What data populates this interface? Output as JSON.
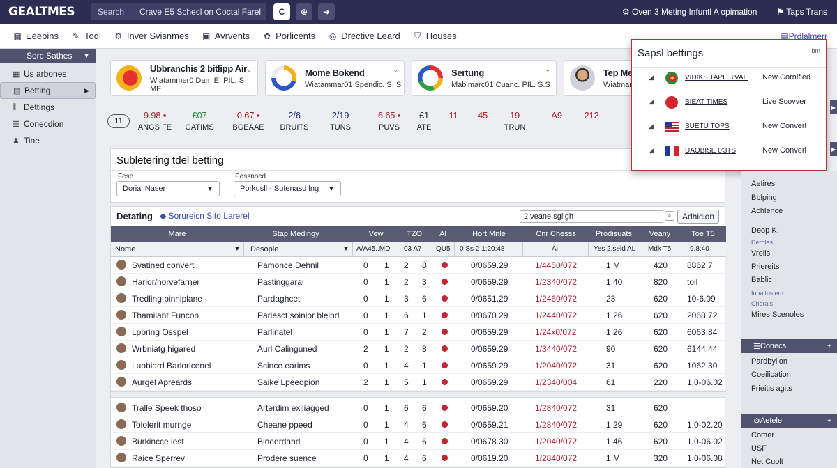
{
  "header": {
    "logo": "GEALTMES",
    "search_scope": "Search",
    "search_query": "Crave E5 Schecl on Coctal Farel",
    "btn_c": "C",
    "notice": "Oven 3 Meting Infuntl A opimation",
    "user": "Taps Trans"
  },
  "nav": {
    "items": [
      "Eeebins",
      "Todl",
      "Inver Svisnmes",
      "Avrvents",
      "Porlicents",
      "Drective Leard",
      "Houses"
    ],
    "right": "Prdlalmerr"
  },
  "sidebar": {
    "title": "Sorc Sathes",
    "items": [
      {
        "label": "Us arbones",
        "icon": "grid-icon",
        "selected": false
      },
      {
        "label": "Betting",
        "icon": "chart-icon",
        "selected": true
      },
      {
        "label": "Dettings",
        "icon": "bars-icon",
        "selected": false
      },
      {
        "label": "Conecdion",
        "icon": "list-icon",
        "selected": false
      },
      {
        "label": "Tine",
        "icon": "person-icon",
        "selected": false
      }
    ]
  },
  "cards": [
    {
      "title": "Ubbranchis 2 bitlipp Air",
      "subtitle": "Wiatammer0 Dam E. PIL. S ME",
      "icon": "red-yellow-logo"
    },
    {
      "title": "Mome Bokend",
      "subtitle": "Wiatammar01 Spendic. S. S",
      "icon": "blue-ring-logo"
    },
    {
      "title": "Sertung",
      "subtitle": "Mabimarc01 Cuanc. PIL. S.S",
      "icon": "multicolor-ring-logo"
    },
    {
      "title": "Tep Mec",
      "subtitle": "Wiatmanu",
      "icon": "person-avatar"
    }
  ],
  "stats": [
    {
      "value": "9.98 ▪",
      "label": "ANGS FE",
      "color": "red"
    },
    {
      "value": "£07",
      "label": "GATIMS",
      "color": "green"
    },
    {
      "value": "0.67 ▪",
      "label": "BGEAAE",
      "color": "red"
    },
    {
      "value": "2/6",
      "label": "DRUITS",
      "color": "blue"
    },
    {
      "value": "2/19",
      "label": "TUNS",
      "color": "blue"
    },
    {
      "value": "6.65 ▪",
      "label": "PUVS",
      "color": "red"
    },
    {
      "value": "£1",
      "label": "ATE",
      "color": "dark"
    },
    {
      "value": "11",
      "label": "",
      "color": "red"
    },
    {
      "value": "45",
      "label": "",
      "color": "red"
    },
    {
      "value": "19",
      "label": "TRUN",
      "color": "red"
    },
    {
      "value": "A9",
      "label": "",
      "color": "red"
    },
    {
      "value": "212",
      "label": "",
      "color": "red"
    }
  ],
  "stats_pill": "11",
  "settings": {
    "title": "Subletering tdel betting",
    "label1": "Fese",
    "select1": "Dorial Naser",
    "label2": "Pessnocd",
    "select2": "Porkusll - Sutenasd lng"
  },
  "table": {
    "title": "Detating",
    "subtitle": "Sorureicn Sito Larerel",
    "search": "2 veane.sgiigh",
    "add_label": "Adhicion",
    "columns": [
      "Mare",
      "Stap Medingy",
      "Vew",
      "TZO",
      "Al",
      "Hort Mnle",
      "Cnr Chesss",
      "Prodisuats",
      "Veany",
      "Toe T5"
    ],
    "subheader": [
      "Nome",
      "Desopie",
      "A/A45..MD",
      "03 A7",
      "QU5",
      "0 Ss 2 1:20:48",
      "Al",
      "Yes 2.seld AL",
      "Mdk T5",
      "9.8:40"
    ],
    "rows": [
      {
        "name": "Svatined convert",
        "desc": "Pamonce Dehnil",
        "a": "0",
        "b": "1",
        "c": "2",
        "d": "8",
        "time": "0/0659.29",
        "ratio": "1/4450/072",
        "prod": "1 M",
        "val": "420",
        "total": "8862.7"
      },
      {
        "name": "Harlor/horvefarner",
        "desc": "Pastinggarai",
        "a": "0",
        "b": "1",
        "c": "2",
        "d": "3",
        "time": "0/0659.29",
        "ratio": "1/2340/072",
        "prod": "1 40",
        "val": "820",
        "total": "toll"
      },
      {
        "name": "Tredling pinniplane",
        "desc": "Pardaghcet",
        "a": "0",
        "b": "1",
        "c": "3",
        "d": "6",
        "time": "0/0651.29",
        "ratio": "1/2460/072",
        "prod": "23",
        "val": "620",
        "total": "10-6.09"
      },
      {
        "name": "Thamilant Funcon",
        "desc": "Pariesct soinior bleind",
        "a": "0",
        "b": "1",
        "c": "6",
        "d": "1",
        "time": "0/0670.29",
        "ratio": "1/2440/072",
        "prod": "1 26",
        "val": "620",
        "total": "2068.72"
      },
      {
        "name": "Lpbring Osspel",
        "desc": "Parlinatel",
        "a": "0",
        "b": "1",
        "c": "7",
        "d": "2",
        "time": "0/0659.29",
        "ratio": "1/24x0/072",
        "prod": "1 26",
        "val": "620",
        "total": "6063.84"
      },
      {
        "name": "Wrbniatg higared",
        "desc": "Aurl Calinguned",
        "a": "2",
        "b": "1",
        "c": "2",
        "d": "8",
        "time": "0/0659.29",
        "ratio": "1/3440/072",
        "prod": "90",
        "val": "620",
        "total": "6144.44"
      },
      {
        "name": "Luobiard Barloricenel",
        "desc": "Scince earims",
        "a": "0",
        "b": "1",
        "c": "4",
        "d": "1",
        "time": "0/0659.29",
        "ratio": "1/2040/072",
        "prod": "31",
        "val": "620",
        "total": "1062.30"
      },
      {
        "name": "Aurgel Apreards",
        "desc": "Saike Lpeeopion",
        "a": "2",
        "b": "1",
        "c": "5",
        "d": "1",
        "time": "0/0659.29",
        "ratio": "1/2340/004",
        "prod": "61",
        "val": "220",
        "total": "1.0-06.02"
      },
      {
        "name": "Tralle Speek thoso",
        "desc": "Arterdim exiliagged",
        "a": "0",
        "b": "1",
        "c": "6",
        "d": "6",
        "time": "0/0659.20",
        "ratio": "1/2840/072",
        "prod": "31",
        "val": "620",
        "total": ""
      },
      {
        "name": "Tololerit murnge",
        "desc": "Cheane ppeed",
        "a": "0",
        "b": "1",
        "c": "4",
        "d": "6",
        "time": "0/0659.21",
        "ratio": "1/2840/072",
        "prod": "1 29",
        "val": "620",
        "total": "1.0-02.20"
      },
      {
        "name": "Burkincce lest",
        "desc": "Bineerdahd",
        "a": "0",
        "b": "1",
        "c": "4",
        "d": "6",
        "time": "0/0678.30",
        "ratio": "1/2040/072",
        "prod": "1 46",
        "val": "620",
        "total": "1.0-06.02"
      },
      {
        "name": "Raice Sperrev",
        "desc": "Prodere suence",
        "a": "0",
        "b": "1",
        "c": "4",
        "d": "6",
        "time": "0/0619.20",
        "ratio": "1/2840/072",
        "prod": "1 M",
        "val": "320",
        "total": "1.0-06.08"
      }
    ]
  },
  "popup": {
    "title": "Sapsl bettings",
    "close": "bm",
    "rows": [
      {
        "link": "VIDIKS TAPE.3'VAE",
        "status": "New Cornifled",
        "flag": "portugal"
      },
      {
        "link": "BIEAT TIMES",
        "status": "Live Scovver",
        "flag": "japan"
      },
      {
        "link": "SUETU TOPS",
        "status": "New Converl",
        "flag": "usa"
      },
      {
        "link": "UAOBISE 0'3TS",
        "status": "New Converl",
        "flag": "france"
      }
    ]
  },
  "right_panel": {
    "items1": [
      "Aetires",
      "Bblping",
      "Achlence",
      "Deop K.",
      "Deroles",
      "Vreils",
      "Priereits",
      "Bablic",
      "Inhaitoslem",
      "Cherals",
      "Mires Scenoles"
    ],
    "section2": "Conecs",
    "items2": [
      "Pardbylion",
      "Coeilication",
      "Frieitis agits"
    ],
    "section3": "Aetele",
    "items3": [
      "Comer",
      "USF",
      "Net Cuolt"
    ]
  },
  "colors": {
    "topbar": "#2b2d52",
    "accent_red": "#c42c34",
    "link_blue": "#3a4cb0",
    "table_header": "#5a5c74"
  }
}
